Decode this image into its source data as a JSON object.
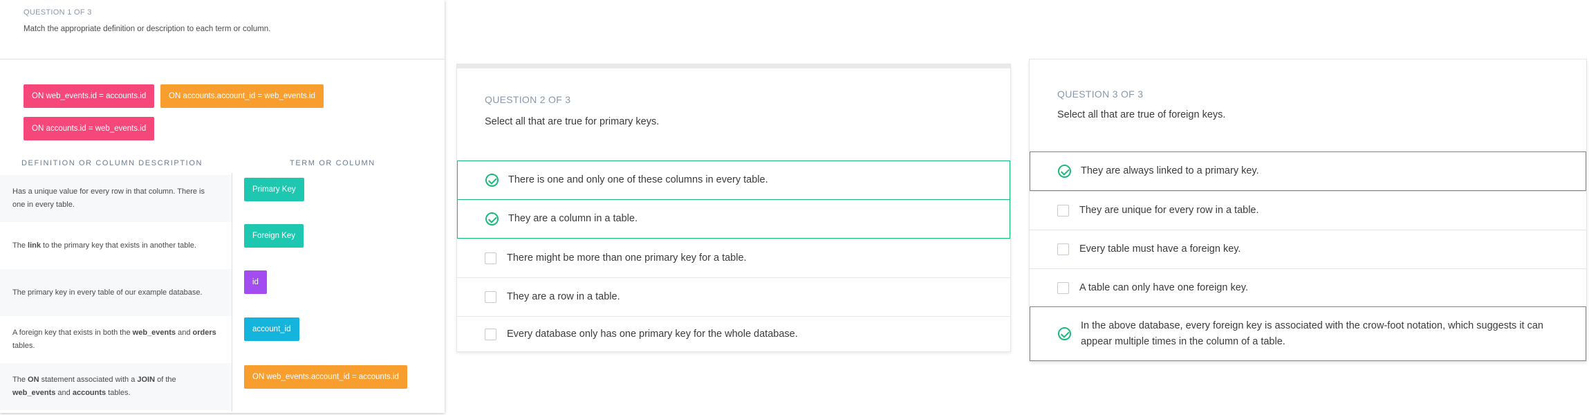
{
  "q1": {
    "heading": "QUESTION 1 OF 3",
    "prompt": "Match the appropriate definition or description to each term or column.",
    "pool_chips": [
      {
        "label": "ON web_events.id = accounts.id",
        "color": "#f5477a"
      },
      {
        "label": "ON accounts.account_id = web_events.id",
        "color": "#f89e2f"
      },
      {
        "label": "ON accounts.id = web_events.id",
        "color": "#f5477a"
      }
    ],
    "col_left": "DEFINITION OR COLUMN DESCRIPTION",
    "col_right": "TERM OR COLUMN",
    "rows": [
      {
        "desc": "Has a unique value for every row in that column. There is one in every table.",
        "term": "Primary Key"
      },
      {
        "desc": "The link to the primary key that exists in another table.",
        "term": "Foreign Key"
      },
      {
        "desc": "The primary key in every table of our example database.",
        "term": "id"
      },
      {
        "desc": "A foreign key that exists in both the web_events and orders tables.",
        "term": "account_id"
      },
      {
        "desc": "The ON statement associated with a JOIN of the web_events and accounts tables.",
        "term": "ON web_events.account_id = accounts.id"
      }
    ]
  },
  "q2": {
    "heading": "QUESTION 2 OF 3",
    "prompt": "Select all that are true for primary keys.",
    "options": [
      {
        "text": "There is one and only one of these columns in every table.",
        "selected": true
      },
      {
        "text": "They are a column in a table.",
        "selected": true
      },
      {
        "text": "There might be more than one primary key for a table.",
        "selected": false
      },
      {
        "text": "They are a row in a table.",
        "selected": false
      },
      {
        "text": "Every database only has one primary key for the whole database.",
        "selected": false
      }
    ]
  },
  "q3": {
    "heading": "QUESTION 3 OF 3",
    "prompt": "Select all that are true of foreign keys.",
    "options": [
      {
        "text": "They are always linked to a primary key.",
        "selected": true
      },
      {
        "text": "They are unique for every row in a table.",
        "selected": false
      },
      {
        "text": "Every table must have a foreign key.",
        "selected": false
      },
      {
        "text": "A table can only have one foreign key.",
        "selected": false
      },
      {
        "text": "In the above database, every foreign key is associated with the crow-foot notation, which suggests it can appear multiple times in the column of a table.",
        "selected": true
      }
    ]
  },
  "colors": {
    "selected_green": "#1bb97a",
    "pink": "#f5477a",
    "orange": "#f89e2f",
    "teal": "#1ec8b0",
    "purple": "#a34cf0",
    "cyan": "#15b4dd"
  }
}
